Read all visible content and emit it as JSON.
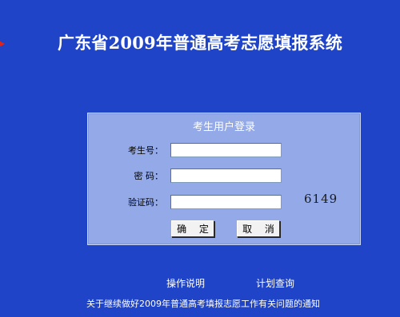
{
  "header": {
    "title": "广东省2009年普通高考志愿填报系统"
  },
  "login": {
    "title": "考生用户登录",
    "labels": {
      "exam_number": "考生号：",
      "password": "密 码：",
      "captcha": "验证码："
    },
    "values": {
      "exam_number": "",
      "password": "",
      "captcha": ""
    },
    "captcha_code": "6149",
    "buttons": {
      "confirm": "确 定",
      "cancel": "取 消"
    }
  },
  "links": {
    "instructions": "操作说明",
    "plan_query": "计划查询",
    "notice": "关于继续做好2009年普通高考填报志愿工作有关问题的通知"
  },
  "colors": {
    "background": "#1f44c8",
    "panel": "#93a9e8",
    "accent_arrow": "#e2231a"
  }
}
